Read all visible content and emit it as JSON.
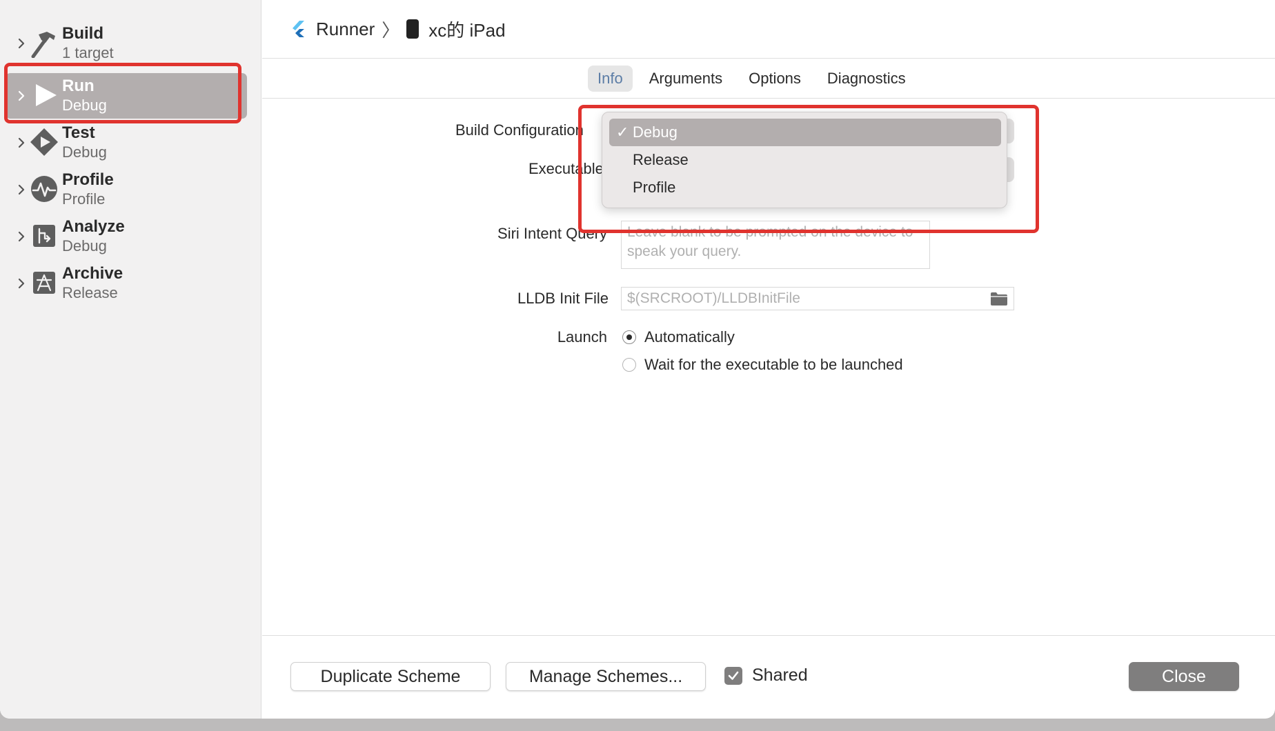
{
  "breadcrumb": {
    "project": "Runner",
    "device": "xc的 iPad"
  },
  "sidebar": {
    "actions": [
      {
        "name": "Build",
        "subtitle": "1 target",
        "icon": "hammer-icon"
      },
      {
        "name": "Run",
        "subtitle": "Debug",
        "icon": "play-icon",
        "selected": true
      },
      {
        "name": "Test",
        "subtitle": "Debug",
        "icon": "test-diamond-icon"
      },
      {
        "name": "Profile",
        "subtitle": "Profile",
        "icon": "waveform-icon"
      },
      {
        "name": "Analyze",
        "subtitle": "Debug",
        "icon": "analyze-icon"
      },
      {
        "name": "Archive",
        "subtitle": "Release",
        "icon": "archive-icon"
      }
    ]
  },
  "tabs": [
    {
      "label": "Info",
      "active": true
    },
    {
      "label": "Arguments"
    },
    {
      "label": "Options"
    },
    {
      "label": "Diagnostics"
    }
  ],
  "form": {
    "build_configuration_label": "Build Configuration",
    "executable_label": "Executable",
    "siri_label": "Siri Intent Query",
    "siri_placeholder": "Leave blank to be prompted on the device to speak your query.",
    "lldb_label": "LLDB Init File",
    "lldb_placeholder": "$(SRCROOT)/LLDBInitFile",
    "launch_label": "Launch",
    "launch_options": [
      {
        "label": "Automatically",
        "selected": true
      },
      {
        "label": "Wait for the executable to be launched",
        "selected": false
      }
    ]
  },
  "dropdown": {
    "items": [
      {
        "label": "Debug",
        "selected": true
      },
      {
        "label": "Release"
      },
      {
        "label": "Profile"
      }
    ],
    "check_glyph": "✓"
  },
  "footer": {
    "duplicate_label": "Duplicate Scheme",
    "manage_label": "Manage Schemes...",
    "shared_label": "Shared",
    "shared_checked": true,
    "close_label": "Close"
  },
  "colors": {
    "highlight": "#e0332e",
    "selection": "#b3aeae",
    "active_tab_text": "#5c7da6"
  }
}
